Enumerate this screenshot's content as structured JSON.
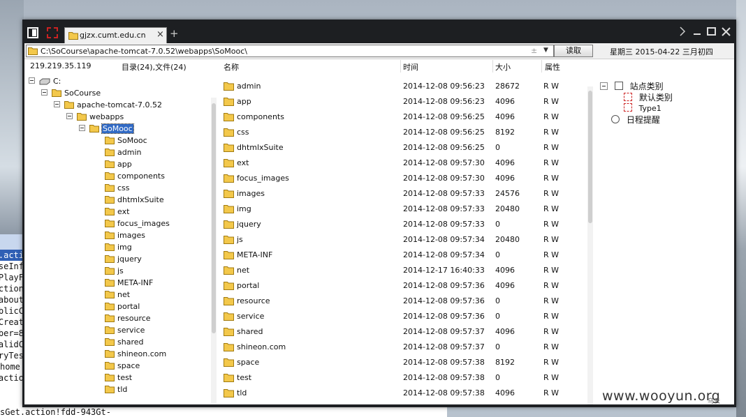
{
  "window": {
    "tab_title": "gjzx.cumt.edu.cn",
    "tab_close": "×",
    "new_tab": "+"
  },
  "toolbar": {
    "path": "C:\\SoCourse\\apache-tomcat-7.0.52\\webapps\\SoMooc\\",
    "path_plusminus": "±",
    "path_dropdown": "▼",
    "read_button": "读取",
    "date_text": "星期三 2015-04-22 三月初四"
  },
  "status": {
    "ip": "219.219.35.119",
    "counts": "目录(24),文件(24)"
  },
  "tree": [
    {
      "label": "C:",
      "level": 0,
      "type": "drive"
    },
    {
      "label": "SoCourse",
      "level": 1,
      "type": "folder"
    },
    {
      "label": "apache-tomcat-7.0.52",
      "level": 2,
      "type": "folder"
    },
    {
      "label": "webapps",
      "level": 3,
      "type": "folder"
    },
    {
      "label": "SoMooc",
      "level": 4,
      "type": "folder",
      "selected": true
    },
    {
      "label": "SoMooc",
      "level": 5,
      "type": "leaf"
    },
    {
      "label": "admin",
      "level": 5,
      "type": "leaf"
    },
    {
      "label": "app",
      "level": 5,
      "type": "leaf"
    },
    {
      "label": "components",
      "level": 5,
      "type": "leaf"
    },
    {
      "label": "css",
      "level": 5,
      "type": "leaf"
    },
    {
      "label": "dhtmlxSuite",
      "level": 5,
      "type": "leaf"
    },
    {
      "label": "ext",
      "level": 5,
      "type": "leaf"
    },
    {
      "label": "focus_images",
      "level": 5,
      "type": "leaf"
    },
    {
      "label": "images",
      "level": 5,
      "type": "leaf"
    },
    {
      "label": "img",
      "level": 5,
      "type": "leaf"
    },
    {
      "label": "jquery",
      "level": 5,
      "type": "leaf"
    },
    {
      "label": "js",
      "level": 5,
      "type": "leaf"
    },
    {
      "label": "META-INF",
      "level": 5,
      "type": "leaf"
    },
    {
      "label": "net",
      "level": 5,
      "type": "leaf"
    },
    {
      "label": "portal",
      "level": 5,
      "type": "leaf"
    },
    {
      "label": "resource",
      "level": 5,
      "type": "leaf"
    },
    {
      "label": "service",
      "level": 5,
      "type": "leaf"
    },
    {
      "label": "shared",
      "level": 5,
      "type": "leaf"
    },
    {
      "label": "shineon.com",
      "level": 5,
      "type": "leaf"
    },
    {
      "label": "space",
      "level": 5,
      "type": "leaf"
    },
    {
      "label": "test",
      "level": 5,
      "type": "leaf"
    },
    {
      "label": "tld",
      "level": 5,
      "type": "leaf"
    }
  ],
  "file_columns": [
    "名称",
    "时间",
    "大小",
    "属性"
  ],
  "files": [
    {
      "name": "admin",
      "time": "2014-12-08 09:56:23",
      "size": "28672",
      "attr": "R W"
    },
    {
      "name": "app",
      "time": "2014-12-08 09:56:23",
      "size": "4096",
      "attr": "R W"
    },
    {
      "name": "components",
      "time": "2014-12-08 09:56:25",
      "size": "4096",
      "attr": "R W"
    },
    {
      "name": "css",
      "time": "2014-12-08 09:56:25",
      "size": "8192",
      "attr": "R W"
    },
    {
      "name": "dhtmlxSuite",
      "time": "2014-12-08 09:56:25",
      "size": "0",
      "attr": "R W"
    },
    {
      "name": "ext",
      "time": "2014-12-08 09:57:30",
      "size": "4096",
      "attr": "R W"
    },
    {
      "name": "focus_images",
      "time": "2014-12-08 09:57:30",
      "size": "4096",
      "attr": "R W"
    },
    {
      "name": "images",
      "time": "2014-12-08 09:57:33",
      "size": "24576",
      "attr": "R W"
    },
    {
      "name": "img",
      "time": "2014-12-08 09:57:33",
      "size": "20480",
      "attr": "R W"
    },
    {
      "name": "jquery",
      "time": "2014-12-08 09:57:33",
      "size": "0",
      "attr": "R W"
    },
    {
      "name": "js",
      "time": "2014-12-08 09:57:34",
      "size": "20480",
      "attr": "R W"
    },
    {
      "name": "META-INF",
      "time": "2014-12-08 09:57:34",
      "size": "0",
      "attr": "R W"
    },
    {
      "name": "net",
      "time": "2014-12-17 16:40:33",
      "size": "4096",
      "attr": "R W"
    },
    {
      "name": "portal",
      "time": "2014-12-08 09:57:36",
      "size": "4096",
      "attr": "R W"
    },
    {
      "name": "resource",
      "time": "2014-12-08 09:57:36",
      "size": "0",
      "attr": "R W"
    },
    {
      "name": "service",
      "time": "2014-12-08 09:57:36",
      "size": "0",
      "attr": "R W"
    },
    {
      "name": "shared",
      "time": "2014-12-08 09:57:37",
      "size": "4096",
      "attr": "R W"
    },
    {
      "name": "shineon.com",
      "time": "2014-12-08 09:57:37",
      "size": "0",
      "attr": "R W"
    },
    {
      "name": "space",
      "time": "2014-12-08 09:57:38",
      "size": "8192",
      "attr": "R W"
    },
    {
      "name": "test",
      "time": "2014-12-08 09:57:38",
      "size": "0",
      "attr": "R W"
    },
    {
      "name": "tld",
      "time": "2014-12-08 09:57:38",
      "size": "4096",
      "attr": "R W"
    }
  ],
  "right_panel": {
    "category_title": "站点类别",
    "items": [
      "默认类别",
      "Type1"
    ],
    "schedule": "日程提醒"
  },
  "background": {
    "code_lines": [
      "e.acti",
      "seInf",
      "PlayF",
      "action",
      "about",
      "blicC",
      "Creat",
      "ber=8",
      "alidC",
      "ryTes",
      "home",
      "actio"
    ],
    "bottom_line": "sGet.action!fdd-943Gt-"
  },
  "watermark": "www.wooyun.org",
  "watermark_small": "乌云"
}
